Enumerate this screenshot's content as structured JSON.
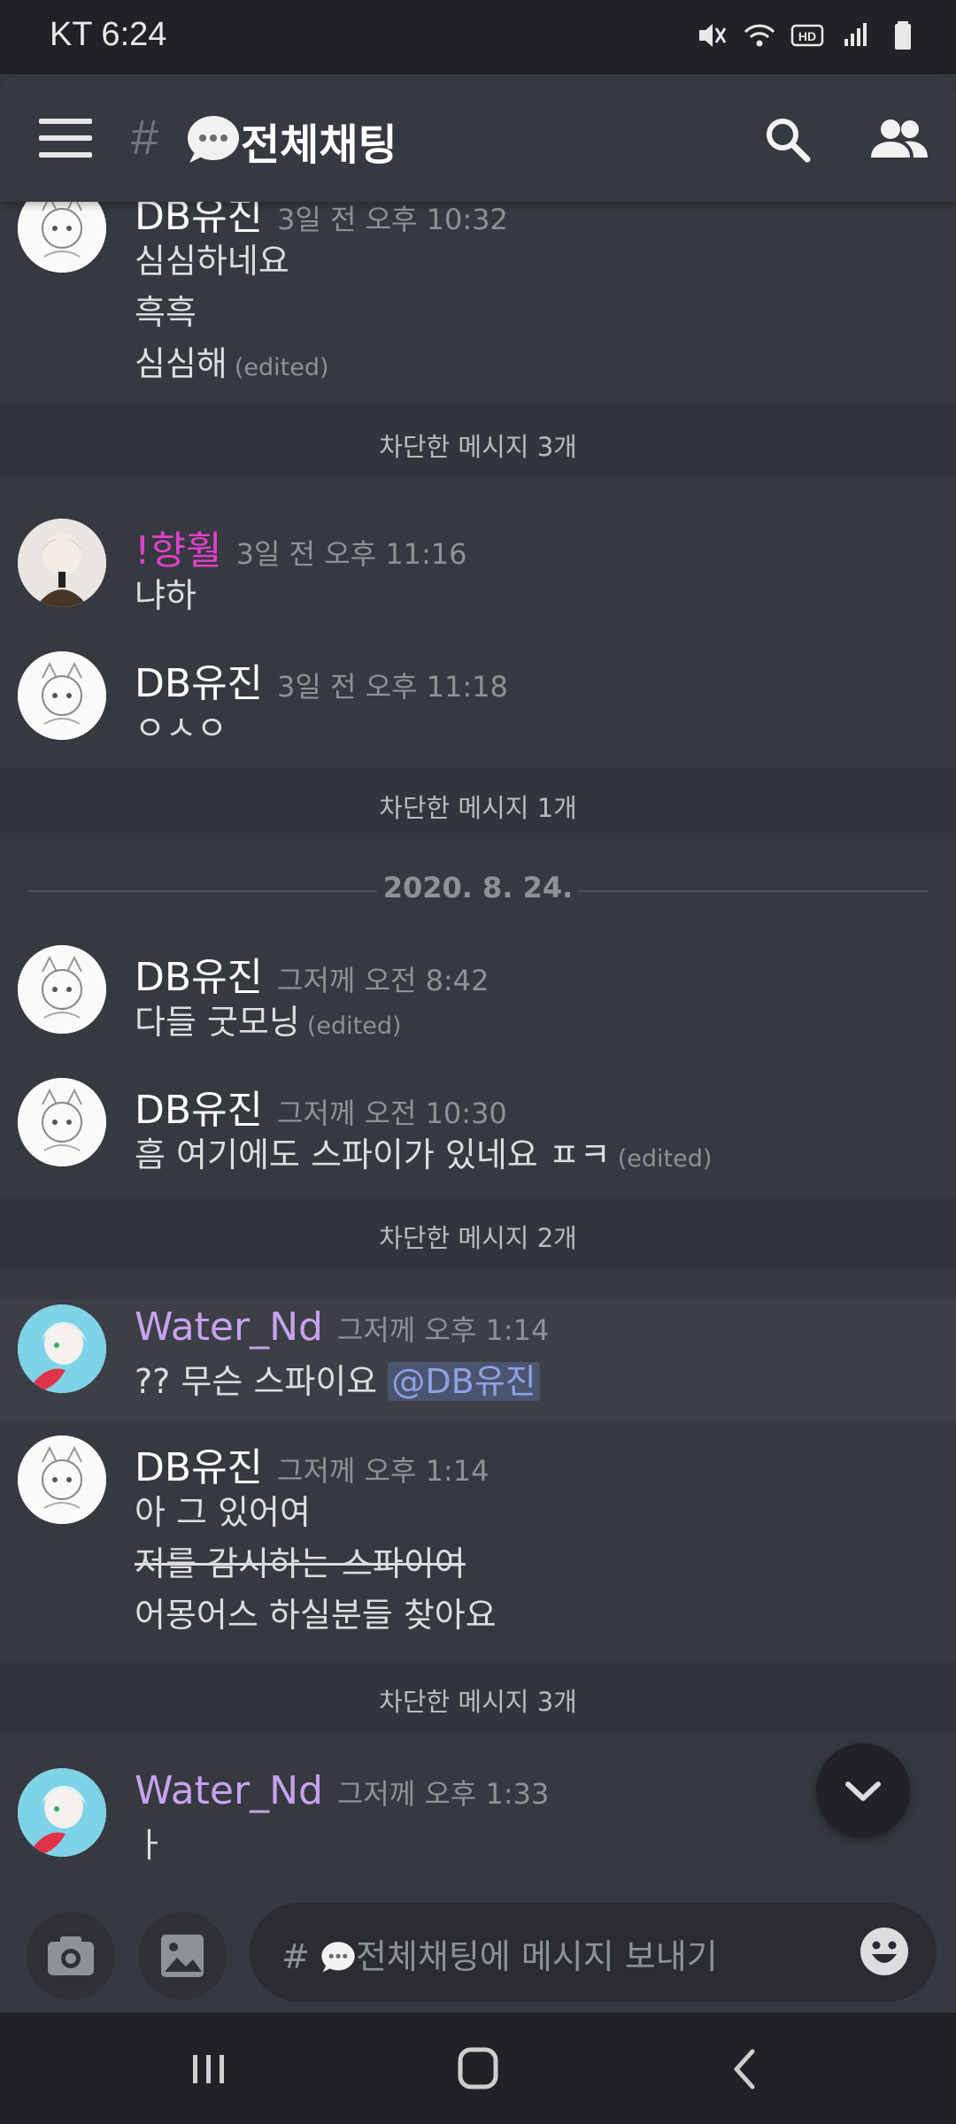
{
  "status_bar": {
    "carrier_time": "KT 6:24"
  },
  "header": {
    "hash": "#",
    "channel_name": "전체채팅"
  },
  "messages": [
    {
      "user": "DB유진",
      "time": "3일 전 오후 10:32",
      "lines": [
        "심심하네요",
        "흑흑",
        "심심해"
      ],
      "edited_label": "(edited)"
    },
    {
      "blocked": "차단한 메시지 3개"
    },
    {
      "user": "!향훨",
      "time": "3일 전 오후 11:16",
      "lines": [
        "냐하"
      ]
    },
    {
      "user": "DB유진",
      "time": "3일 전 오후 11:18",
      "lines": [
        "ㅇㅅㅇ"
      ]
    },
    {
      "blocked": "차단한 메시지 1개"
    },
    {
      "date": "2020. 8. 24."
    },
    {
      "user": "DB유진",
      "time": "그저께 오전 8:42",
      "lines": [
        "다들 굿모닝"
      ],
      "edited_label": "(edited)"
    },
    {
      "user": "DB유진",
      "time": "그저께 오전 10:30",
      "lines": [
        "흠 여기에도 스파이가 있네요 ㅍㅋ"
      ],
      "edited_label": "(edited)"
    },
    {
      "blocked": "차단한 메시지 2개"
    },
    {
      "user": "Water_Nd",
      "time": "그저께 오후 1:14",
      "lines": [
        "?? 무슨 스파이요"
      ],
      "mention": "@DB유진"
    },
    {
      "user": "DB유진",
      "time": "그저께 오후 1:14",
      "lines": [
        "아 그 있어여",
        "저를 감시하는 스파이여",
        "어몽어스 하실분들 찾아요"
      ]
    },
    {
      "blocked": "차단한 메시지 3개"
    },
    {
      "user": "Water_Nd",
      "time": "그저께 오후 1:33",
      "lines": [
        "ㅏ"
      ]
    }
  ],
  "composer": {
    "placeholder_hash": "#",
    "placeholder": "전체채팅에 메시지 보내기"
  },
  "colors": {
    "background": "#36393f",
    "dark": "#202225",
    "pink_user": "#e040c8",
    "purple_user": "#c8a2f0",
    "mention": "#8ea1e1"
  },
  "icons": [
    "hamburger-icon",
    "speech-bubble-icon",
    "search-icon",
    "members-icon",
    "camera-icon",
    "image-icon",
    "emoji-icon",
    "chevron-down-icon",
    "recents-icon",
    "home-icon",
    "back-icon"
  ]
}
